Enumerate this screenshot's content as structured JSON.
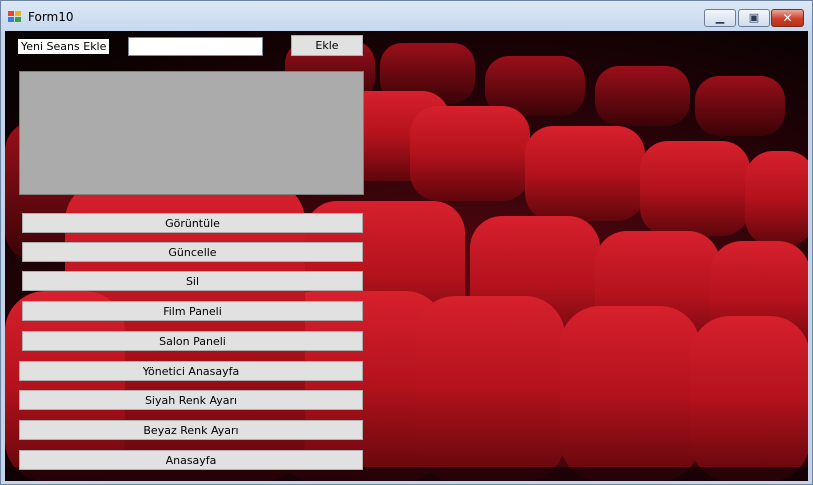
{
  "window": {
    "title": "Form10"
  },
  "form": {
    "label": "Yeni Seans Ekle",
    "input_value": "",
    "add_button": "Ekle"
  },
  "buttons": [
    "Görüntüle",
    "Güncelle",
    "Sil",
    "Film Paneli",
    "Salon  Paneli",
    "Yönetici Anasayfa",
    "Siyah Renk Ayarı",
    "Beyaz Renk Ayarı",
    "Anasayfa"
  ],
  "colors": {
    "seat_red": "#b3121c",
    "grid_gray": "#ababab",
    "button_face": "#e1e1e1"
  }
}
